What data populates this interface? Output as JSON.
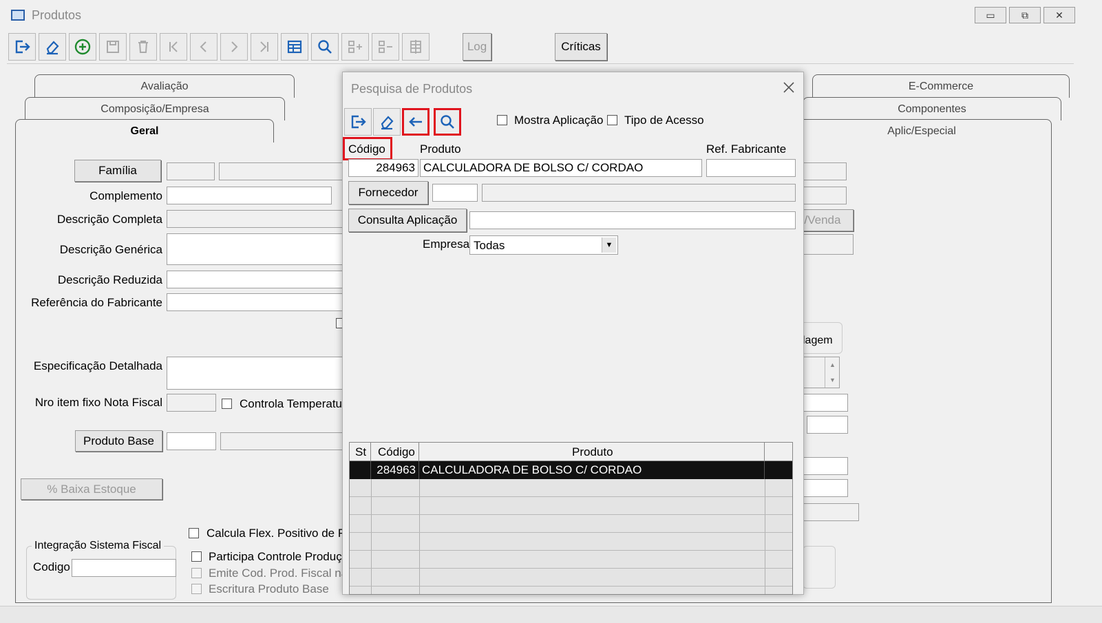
{
  "window": {
    "title": "Produtos"
  },
  "toolbar": {
    "log_label": "Log",
    "criticas_label": "Críticas"
  },
  "tabs_row1": [
    "Avaliação",
    "E-Commerce"
  ],
  "tabs_row2": [
    "Composição/Empresa",
    "Componentes"
  ],
  "tabs_row3": [
    "Geral",
    "Aplic/Especial"
  ],
  "form": {
    "familia_button": "Família",
    "complemento": "Complemento",
    "descricao_completa": "Descrição Completa",
    "descricao_generica": "Descrição Genérica",
    "descricao_reduzida": "Descrição Reduzida",
    "referencia_fabricante": "Referência do Fabricante",
    "especificacao_detalhada": "Especificação Detalhada",
    "nro_item_fixo": "Nro item fixo Nota Fiscal",
    "controla_temperatura": "Controla Temperatura",
    "produto_base_button": "Produto Base",
    "baixa_estoque_button": "% Baixa Estoque",
    "calcula_flex": "Calcula Flex. Positivo de Rep",
    "integracao_group": "Integração Sistema Fiscal",
    "codigo_label": "Codigo",
    "participa_controle": "Participa Controle Produção",
    "emite_cod": "Emite Cod. Prod. Fiscal na N",
    "escritura_produto": "Escritura Produto Base",
    "right_partial_venda": "/Venda",
    "right_partial_agem": "lagem"
  },
  "dialog": {
    "title": "Pesquisa de Produtos",
    "mostra_aplicacao": "Mostra Aplicação",
    "tipo_acesso": "Tipo de Acesso",
    "codigo_label": "Código",
    "produto_label": "Produto",
    "ref_fabricante_label": "Ref. Fabricante",
    "codigo_value": "284963",
    "produto_value": "CALCULADORA DE BOLSO C/ CORDAO",
    "fornecedor_button": "Fornecedor",
    "consulta_aplicacao_button": "Consulta Aplicação",
    "empresa_label": "Empresa",
    "empresa_value": "Todas",
    "grid_headers": [
      "St",
      "Código",
      "Produto"
    ],
    "grid_rows": [
      {
        "st": "",
        "codigo": "284963",
        "produto": "CALCULADORA DE BOLSO C/ CORDAO"
      }
    ]
  }
}
